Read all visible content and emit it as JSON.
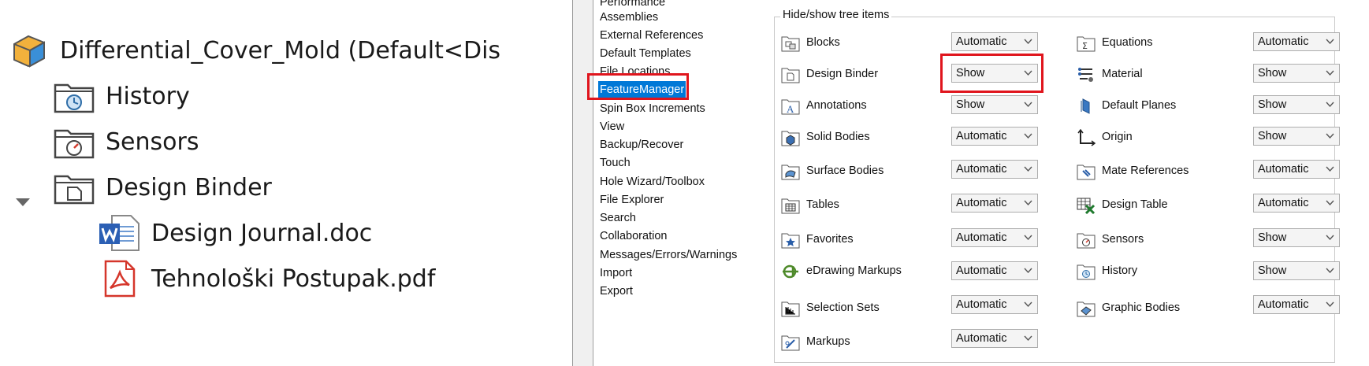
{
  "tree": {
    "items": [
      {
        "label": "Differential_Cover_Mold  (Default<Dis",
        "icon": "part-icon"
      },
      {
        "label": "History",
        "icon": "history-folder-icon"
      },
      {
        "label": "Sensors",
        "icon": "sensors-folder-icon"
      },
      {
        "label": "Design Binder",
        "icon": "design-binder-folder-icon",
        "expanded": true
      },
      {
        "label": "Design Journal.doc",
        "icon": "word-document-icon"
      },
      {
        "label": "Tehnološki Postupak.pdf",
        "icon": "pdf-document-icon"
      }
    ]
  },
  "nav": {
    "items": [
      "Performance",
      "Assemblies",
      "External References",
      "Default Templates",
      "File Locations",
      "FeatureManager",
      "Spin Box Increments",
      "View",
      "Backup/Recover",
      "Touch",
      "Hole Wizard/Toolbox",
      "File Explorer",
      "Search",
      "Collaboration",
      "Messages/Errors/Warnings",
      "Import",
      "Export"
    ],
    "selected": "FeatureManager"
  },
  "group": {
    "title": "Hide/show tree items",
    "left": [
      {
        "label": "Blocks",
        "value": "Automatic",
        "icon": "blocks-icon"
      },
      {
        "label": "Design Binder",
        "value": "Show",
        "icon": "design-binder-icon"
      },
      {
        "label": "Annotations",
        "value": "Show",
        "icon": "annotations-icon"
      },
      {
        "label": "Solid Bodies",
        "value": "Automatic",
        "icon": "solid-bodies-icon"
      },
      {
        "label": "Surface Bodies",
        "value": "Automatic",
        "icon": "surface-bodies-icon"
      },
      {
        "label": "Tables",
        "value": "Automatic",
        "icon": "tables-icon"
      },
      {
        "label": "Favorites",
        "value": "Automatic",
        "icon": "favorites-icon"
      },
      {
        "label": "eDrawing Markups",
        "value": "Automatic",
        "icon": "edrawing-markups-icon"
      },
      {
        "label": "Selection Sets",
        "value": "Automatic",
        "icon": "selection-sets-icon"
      },
      {
        "label": "Markups",
        "value": "Automatic",
        "icon": "markups-icon"
      }
    ],
    "right": [
      {
        "label": "Equations",
        "value": "Automatic",
        "icon": "equations-icon"
      },
      {
        "label": "Material",
        "value": "Show",
        "icon": "material-icon"
      },
      {
        "label": "Default Planes",
        "value": "Show",
        "icon": "default-planes-icon"
      },
      {
        "label": "Origin",
        "value": "Show",
        "icon": "origin-icon"
      },
      {
        "label": "Mate References",
        "value": "Automatic",
        "icon": "mate-references-icon"
      },
      {
        "label": "Design Table",
        "value": "Automatic",
        "icon": "design-table-icon"
      },
      {
        "label": "Sensors",
        "value": "Show",
        "icon": "sensors-icon"
      },
      {
        "label": "History",
        "value": "Show",
        "icon": "history-icon"
      },
      {
        "label": "Graphic Bodies",
        "value": "Automatic",
        "icon": "graphic-bodies-icon"
      }
    ]
  },
  "colors": {
    "highlight": "#e0151d",
    "selection": "#0078d7"
  }
}
